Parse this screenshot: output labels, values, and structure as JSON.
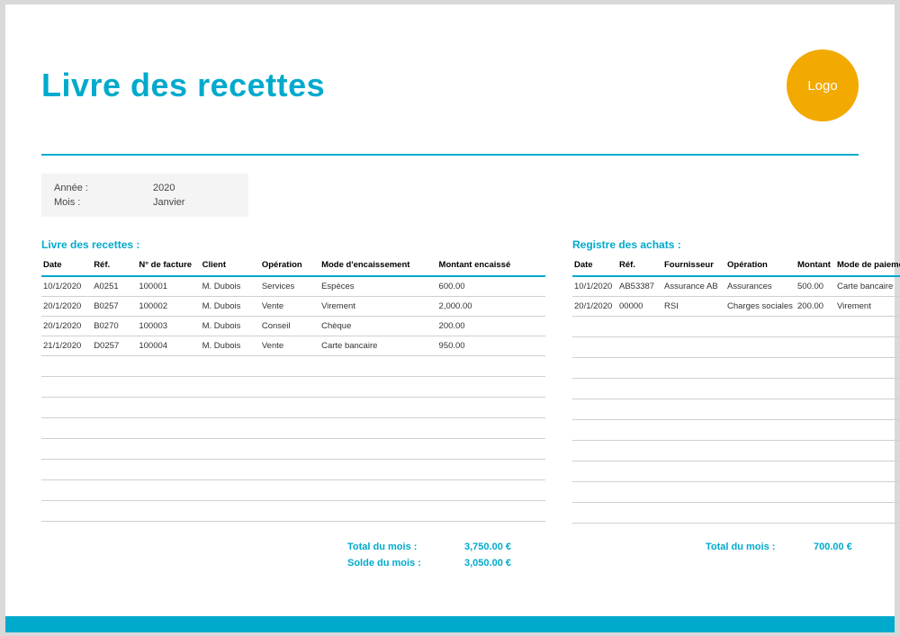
{
  "title": "Livre des recettes",
  "logo_text": "Logo",
  "meta": {
    "year_label": "Année :",
    "year_value": "2020",
    "month_label": "Mois :",
    "month_value": "Janvier"
  },
  "recettes": {
    "section_title": "Livre des recettes :",
    "headers": [
      "Date",
      "Réf.",
      "N° de facture",
      "Client",
      "Opération",
      "Mode d'encaissement",
      "Montant encaissé"
    ],
    "col_widths": [
      "56",
      "50",
      "70",
      "66",
      "66",
      "130",
      "120"
    ],
    "rows": [
      [
        "10/1/2020",
        "A0251",
        "100001",
        "M. Dubois",
        "Services",
        "Espèces",
        "600.00"
      ],
      [
        "20/1/2020",
        "B0257",
        "100002",
        "M. Dubois",
        "Vente",
        "Virement",
        "2,000.00"
      ],
      [
        "20/1/2020",
        "B0270",
        "100003",
        "M. Dubois",
        "Conseil",
        "Chèque",
        "200.00"
      ],
      [
        "21/1/2020",
        "D0257",
        "100004",
        "M. Dubois",
        "Vente",
        "Carte bancaire",
        "950.00"
      ]
    ],
    "empty_rows": 8,
    "total_label": "Total du mois :",
    "total_value": "3,750.00 €",
    "balance_label": "Solde du mois :",
    "balance_value": "3,050.00 €"
  },
  "achats": {
    "section_title": "Registre des achats :",
    "headers": [
      "Date",
      "Réf.",
      "Fournisseur",
      "Opération",
      "Montant",
      "Mode de paiement"
    ],
    "col_widths": [
      "50",
      "50",
      "70",
      "78",
      "44",
      "90"
    ],
    "rows": [
      [
        "10/1/2020",
        "AB53387",
        "Assurance AB",
        "Assurances",
        "500.00",
        "Carte bancaire"
      ],
      [
        "20/1/2020",
        "00000",
        "RSI",
        "Charges sociales",
        "200.00",
        "Virement"
      ]
    ],
    "empty_rows": 10,
    "total_label": "Total du mois :",
    "total_value": "700.00 €"
  }
}
